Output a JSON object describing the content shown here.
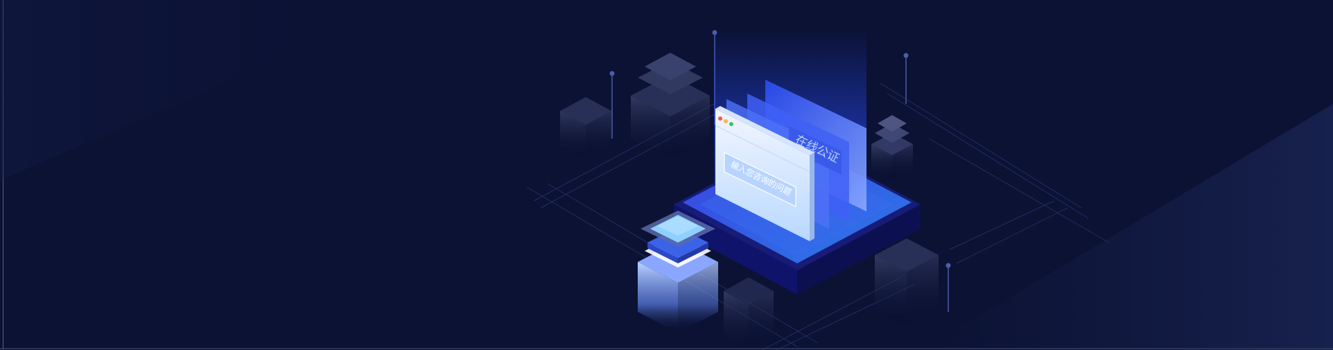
{
  "banner": {
    "back_panel_text": "在线公证",
    "front_panel_text": "输入您咨询的问题"
  },
  "colors": {
    "background": "#0b1234",
    "accent_blue": "#2e56f0",
    "light_blue": "#7fc4ff",
    "window_dot_red": "#f25a4e",
    "window_dot_yellow": "#f5b942",
    "window_dot_green": "#3cc36a"
  },
  "icons": [
    "browser-window-icon",
    "isometric-platform-icon",
    "stacked-cube-icon"
  ]
}
